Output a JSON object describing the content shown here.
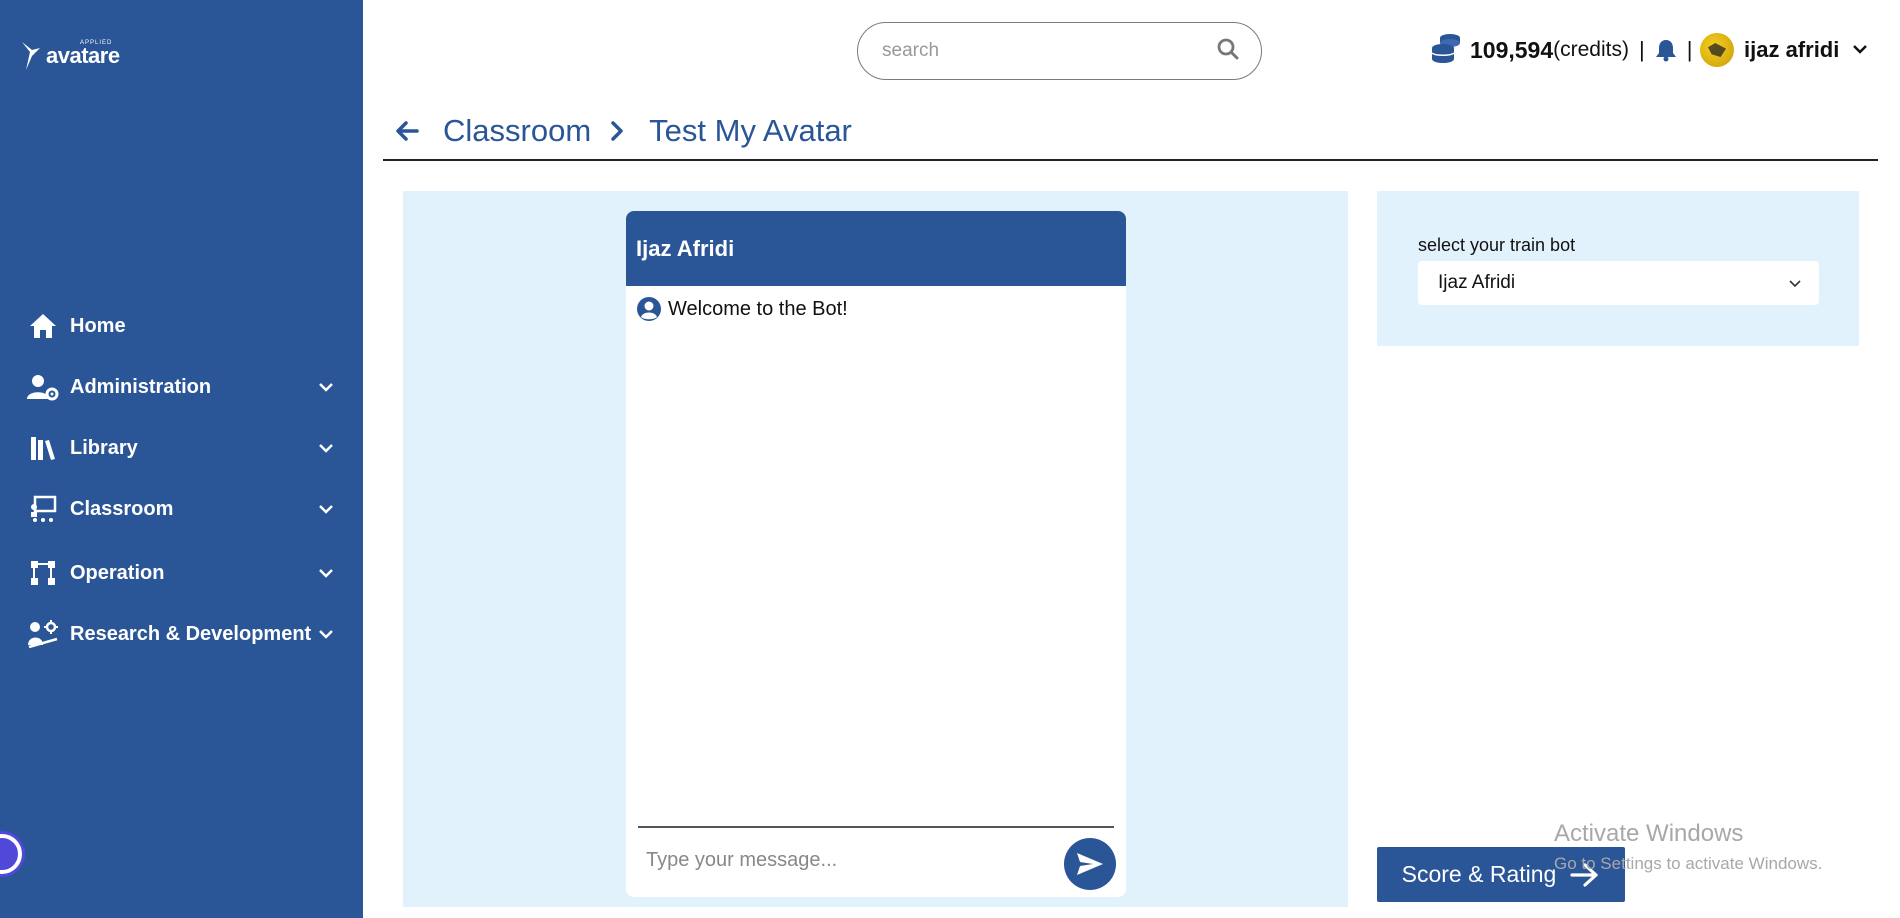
{
  "app": {
    "logo_text": "avatare",
    "logo_sub": "APPLIED"
  },
  "sidebar": {
    "items": [
      {
        "label": "Home",
        "icon": "home-icon"
      },
      {
        "label": "Administration",
        "icon": "user-gear-icon"
      },
      {
        "label": "Library",
        "icon": "library-icon"
      },
      {
        "label": "Classroom",
        "icon": "classroom-icon"
      },
      {
        "label": "Operation",
        "icon": "operation-icon"
      },
      {
        "label": "Research & Development",
        "icon": "research-icon"
      }
    ]
  },
  "header": {
    "search_placeholder": "search",
    "credits_value": "109,594",
    "credits_unit": "(credits)",
    "separator": "|",
    "user_name": "ijaz afridi"
  },
  "breadcrumb": {
    "parent": "Classroom",
    "current": "Test My Avatar"
  },
  "chat": {
    "title": "Ijaz Afridi",
    "welcome": "Welcome to the Bot!",
    "input_placeholder": "Type your message..."
  },
  "bot_select": {
    "label": "select your train bot",
    "value": "Ijaz Afridi"
  },
  "score_button": {
    "label": "Score & Rating"
  },
  "watermark": {
    "line1": "Activate Windows",
    "line2": "Go to Settings to activate Windows."
  },
  "colors": {
    "primary": "#2a5597",
    "panel": "#e1f2fd"
  }
}
